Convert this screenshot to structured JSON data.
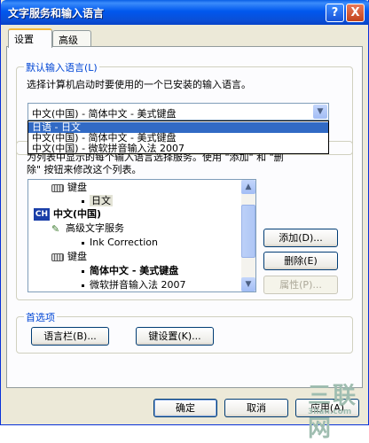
{
  "window": {
    "title": "文字服务和输入语言"
  },
  "titlebar": {
    "help_label": "?",
    "close_label": "X"
  },
  "tabs": [
    {
      "label": "设置"
    },
    {
      "label": "高级"
    }
  ],
  "default_language": {
    "group_title": "默认输入语言(L)",
    "description": "选择计算机启动时要使用的一个已安装的输入语言。",
    "selected_value": "中文(中国) - 简体中文 - 美式键盘",
    "dropdown_options": [
      "日语 - 日文",
      "中文(中国) - 简体中文 - 美式键盘",
      "中文(中国) - 微软拼音输入法 2007"
    ],
    "selected_option_index": 0
  },
  "installed_services": {
    "desc_line1": "为列表中显示的每个输入语言选择服务。使用 \"添加\" 和 \"删",
    "desc_line2": "除\" 按钮来修改这个列表。",
    "items": [
      {
        "text": "键盘",
        "kind": "keyboard",
        "level": 1
      },
      {
        "text": "日文",
        "kind": "bullet",
        "level": 2,
        "highlight": true
      },
      {
        "text": "中文(中国)",
        "kind": "language",
        "level": 0,
        "icon_text": "CH",
        "bold": true
      },
      {
        "text": "高级文字服务",
        "kind": "service",
        "level": 1
      },
      {
        "text": "Ink Correction",
        "kind": "bullet",
        "level": 2
      },
      {
        "text": "键盘",
        "kind": "keyboard",
        "level": 1
      },
      {
        "text": "简体中文 - 美式键盘",
        "kind": "bullet",
        "level": 2,
        "bold": true
      },
      {
        "text": "微软拼音输入法 2007",
        "kind": "bullet",
        "level": 2
      }
    ],
    "add_button": "添加(D)...",
    "remove_button": "删除(E)",
    "properties_button": "属性(P)..."
  },
  "preferences": {
    "group_title": "首选项",
    "language_bar_button": "语言栏(B)...",
    "key_settings_button": "键设置(K)..."
  },
  "footer": {
    "ok_button": "确定",
    "cancel_button": "取消",
    "apply_button": "应用(A)"
  },
  "watermark": {
    "big": "三联网",
    "small": "3lian.com"
  }
}
